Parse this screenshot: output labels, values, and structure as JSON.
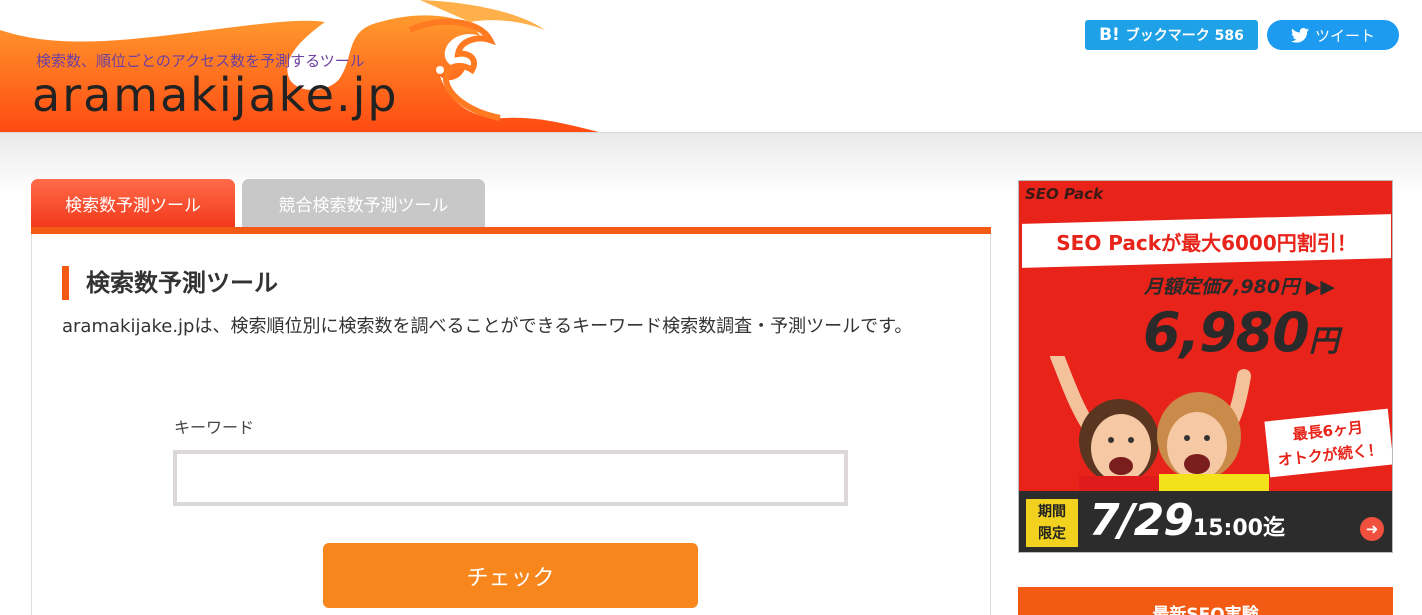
{
  "header": {
    "tagline": "検索数、順位ごとのアクセス数を予測するツール",
    "logo": "aramakijake.jp",
    "hatena_mark": "B!",
    "hatena_label": "ブックマーク 586",
    "tweet_label": "ツイート"
  },
  "tabs": [
    {
      "label": "検索数予測ツール",
      "active": true
    },
    {
      "label": "競合検索数予測ツール",
      "active": false
    }
  ],
  "main": {
    "section_title": "検索数予測ツール",
    "description": "aramakijake.jpは、検索順位別に検索数を調べることができるキーワード検索数調査・予測ツールです。",
    "keyword_label": "キーワード",
    "keyword_value": "",
    "check_label": "チェック"
  },
  "ad": {
    "brand": "SEO Pack",
    "headline": "SEO Packが最大6000円割引！",
    "regular_price": "月額定価7,980円 ▶▶",
    "price_value": "6,980",
    "price_unit": "円",
    "bubble_line1": "最長6ヶ月",
    "bubble_line2": "オトクが続く！",
    "period_line1": "期間",
    "period_line2": "限定",
    "deadline_date": "7/29",
    "deadline_time": "15:00迄",
    "arrow": "➜"
  },
  "sidebar": {
    "heading": "最新SEO実験"
  },
  "colors": {
    "accent": "#f35a14",
    "button": "#f7871d",
    "hatena": "#1ea1e6",
    "twitter": "#1d9bf0",
    "ad_red": "#e8231a"
  }
}
